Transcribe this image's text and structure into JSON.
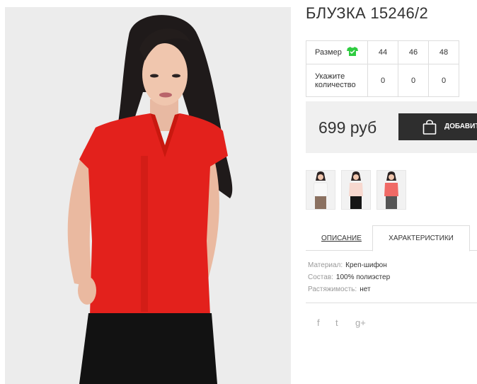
{
  "product": {
    "title": "БЛУЗКА 15246/2",
    "price": "699 руб",
    "add_to_cart_label": "ДОБАВИТЬ"
  },
  "size_table": {
    "size_label": "Размер",
    "quantity_label_line1": "Укажите",
    "quantity_label_line2": "количество",
    "sizes": [
      "44",
      "46",
      "48"
    ],
    "quantities": [
      "0",
      "0",
      "0"
    ]
  },
  "thumbnails": [
    {
      "name": "white-blouse"
    },
    {
      "name": "pink-blouse"
    },
    {
      "name": "coral-blouse"
    }
  ],
  "tabs": {
    "description": "ОПИСАНИЕ",
    "characteristics": "ХАРАКТЕРИСТИКИ",
    "active": "characteristics"
  },
  "specs": [
    {
      "key": "Материал:",
      "value": "Креп-шифон"
    },
    {
      "key": "Состав:",
      "value": "100% полиэстер"
    },
    {
      "key": "Растяжимость:",
      "value": "нет"
    }
  ],
  "social": {
    "facebook": "f",
    "twitter": "t",
    "googleplus": "g+"
  },
  "colors": {
    "accent_green": "#2ecc40",
    "button_dark": "#2e2e2e",
    "price_bar": "#f0f0f0",
    "blouse_red": "#e3211c"
  }
}
